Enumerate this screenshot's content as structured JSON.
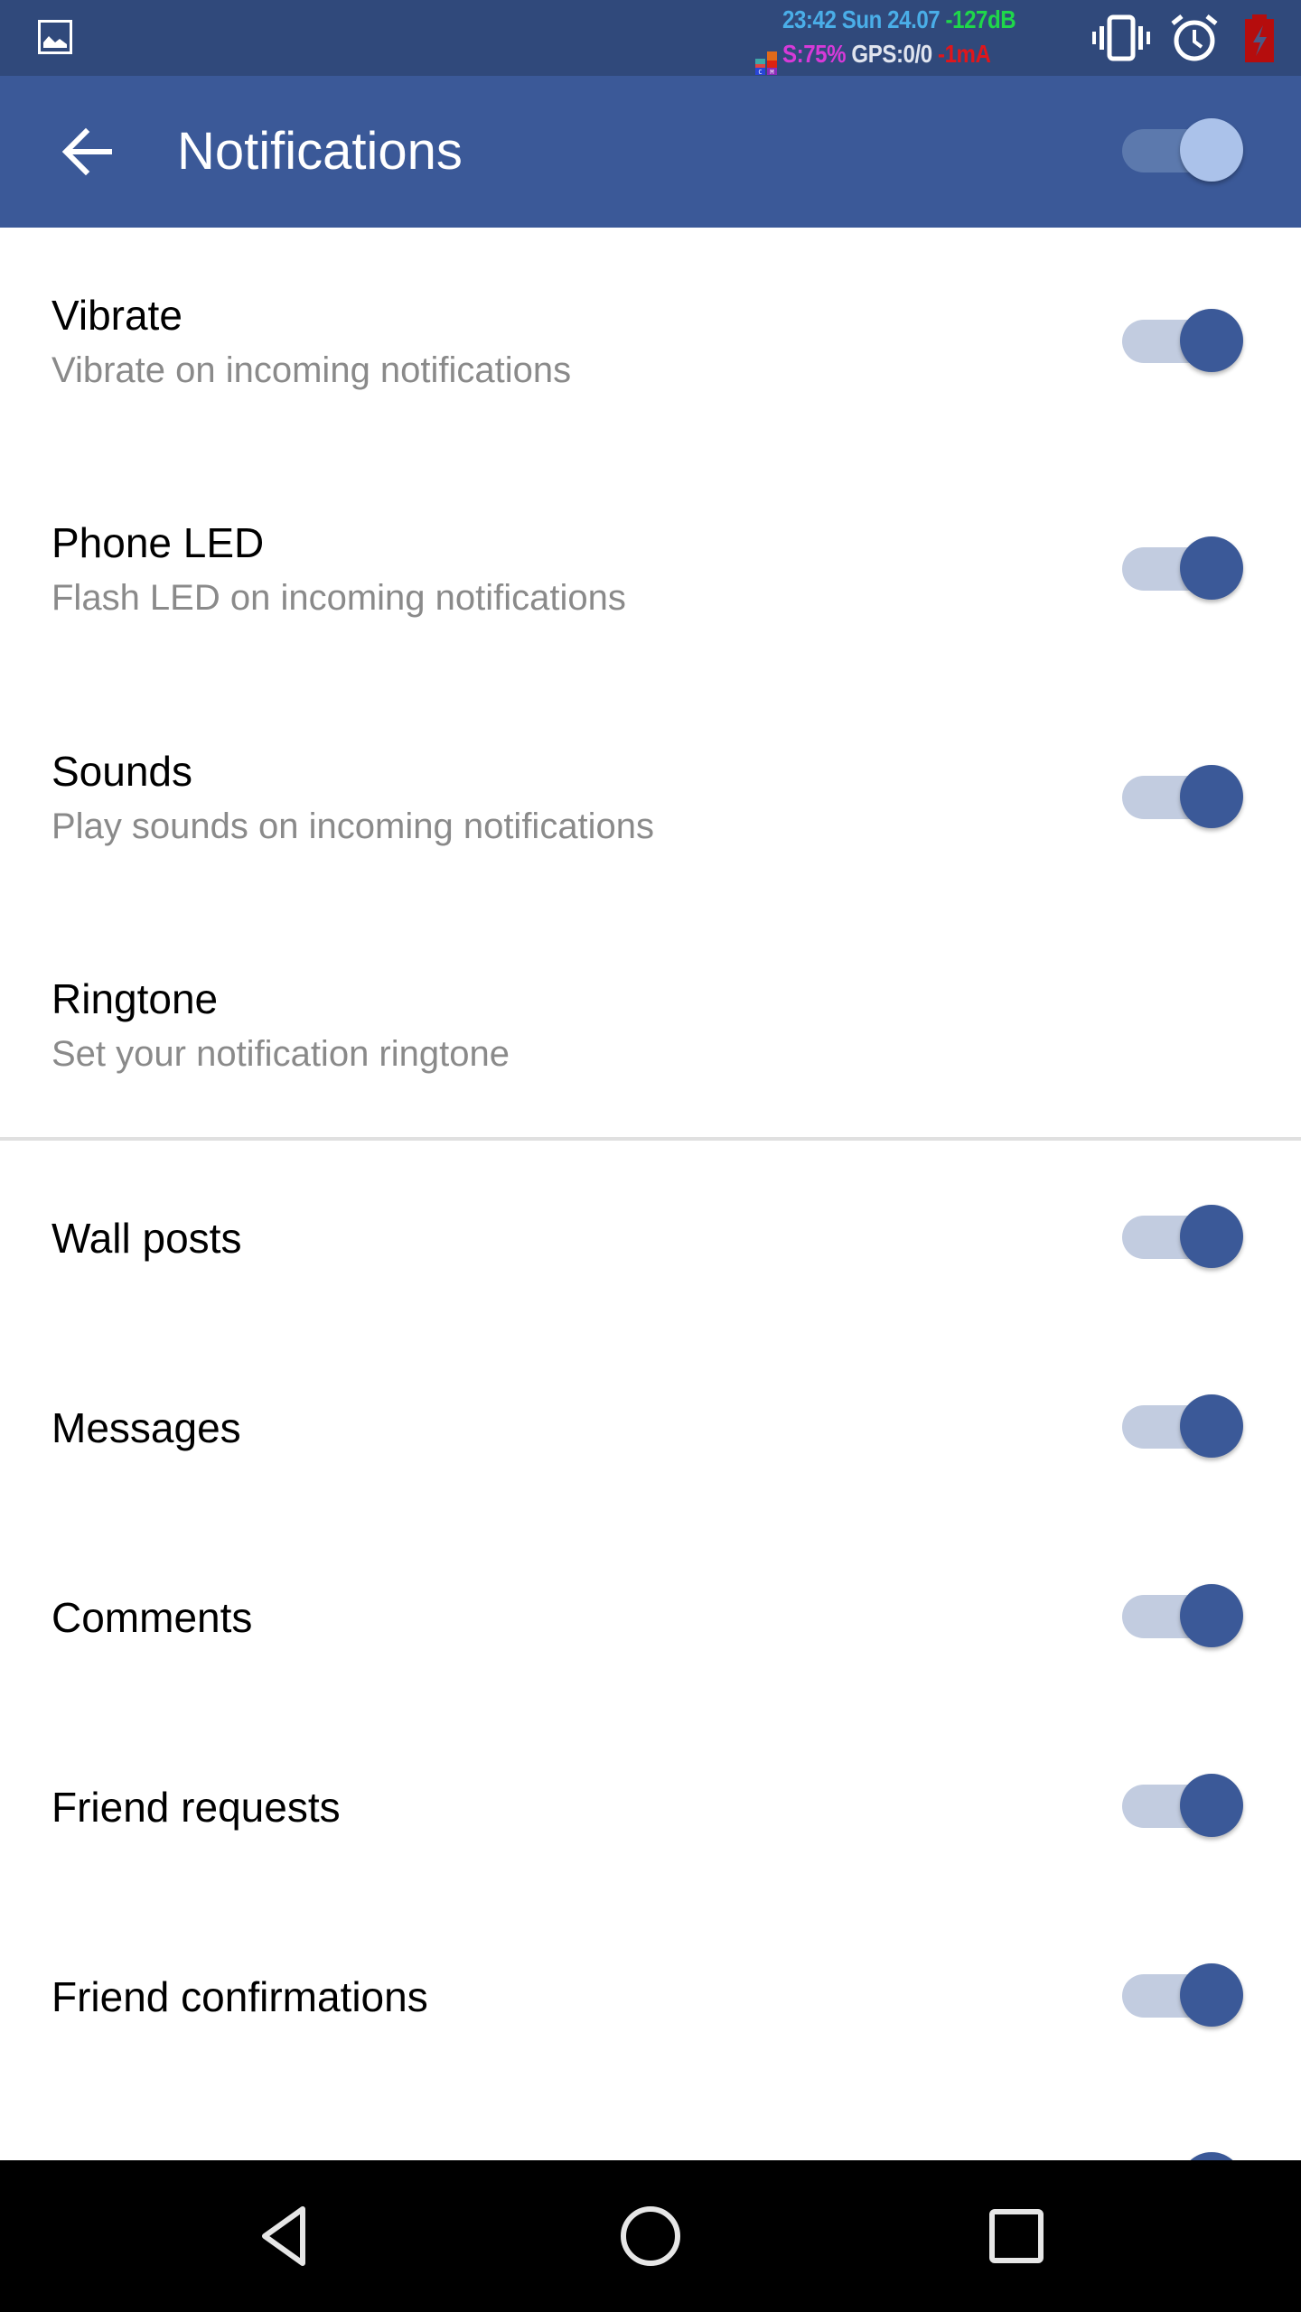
{
  "status_bar": {
    "time_date": "23:42 Sun 24.07",
    "signal": "-127dB",
    "storage": "S:75%",
    "gps": "GPS:0/0",
    "current": "-1mA",
    "cm_badge": "CM",
    "icons": [
      "image-icon",
      "cm-widget-icon",
      "vibrate-icon",
      "alarm-icon",
      "battery-charging-icon"
    ],
    "colors": {
      "background": "#30497b",
      "time": "#4aaee8",
      "signal": "#1fd74a",
      "storage": "#d63ad8",
      "gps": "#e0e4ee",
      "current": "#e0161b",
      "battery": "#b50d0d"
    }
  },
  "toolbar": {
    "title": "Notifications",
    "back_icon": "arrow-left-icon",
    "master_switch_on": true,
    "color": "#3b5998"
  },
  "settings": {
    "detailed": [
      {
        "title": "Vibrate",
        "subtitle": "Vibrate on incoming notifications",
        "has_switch": true,
        "on": true
      },
      {
        "title": "Phone LED",
        "subtitle": "Flash LED on incoming notifications",
        "has_switch": true,
        "on": true
      },
      {
        "title": "Sounds",
        "subtitle": "Play sounds on incoming notifications",
        "has_switch": true,
        "on": true
      },
      {
        "title": "Ringtone",
        "subtitle": "Set your notification ringtone",
        "has_switch": false
      }
    ],
    "types": [
      {
        "title": "Wall posts",
        "on": true
      },
      {
        "title": "Messages",
        "on": true
      },
      {
        "title": "Comments",
        "on": true
      },
      {
        "title": "Friend requests",
        "on": true
      },
      {
        "title": "Friend confirmations",
        "on": true
      },
      {
        "title": "",
        "on": true
      }
    ]
  },
  "nav_bar": {
    "buttons": [
      "back-triangle-icon",
      "home-circle-icon",
      "recents-square-icon"
    ]
  }
}
